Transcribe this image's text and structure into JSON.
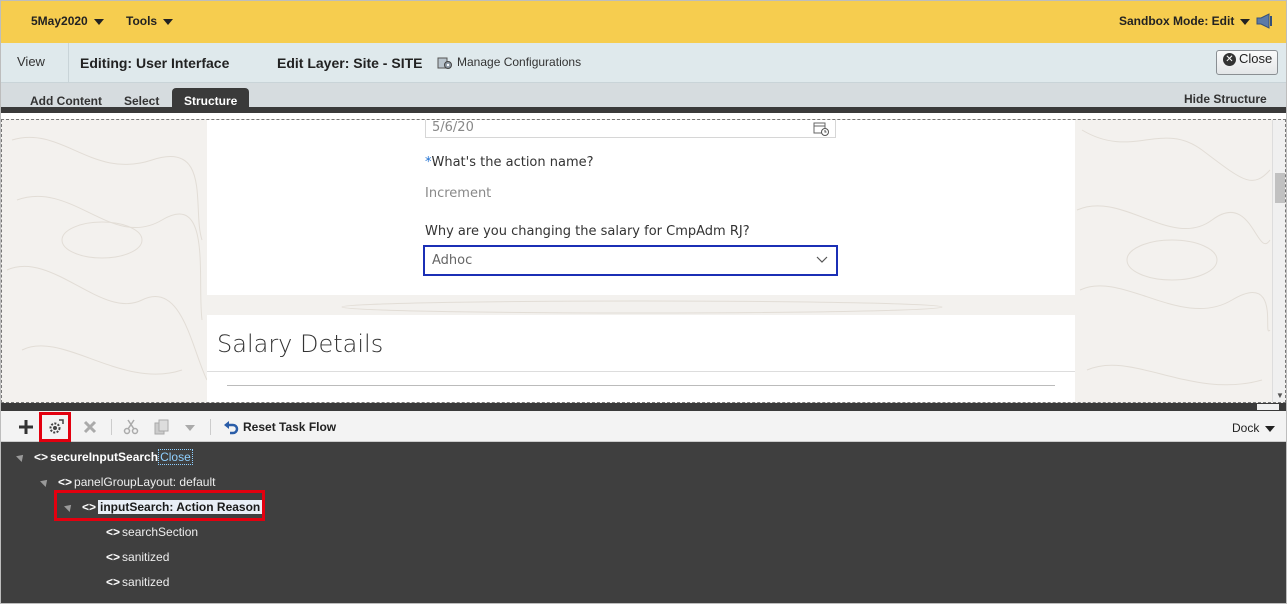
{
  "topbar": {
    "date_menu": "5May2020",
    "tools_menu": "Tools",
    "sandbox_mode": "Sandbox Mode: Edit",
    "colors": {
      "bar": "#f6cd4f"
    },
    "icons": [
      "chevron-down-icon",
      "megaphone-icon"
    ]
  },
  "editbar": {
    "view_tab": "View",
    "editing": "Editing: User Interface",
    "edit_layer": "Edit Layer: Site - SITE",
    "manage_configurations": "Manage Configurations",
    "close_button": "Close"
  },
  "tabs": {
    "items": [
      "Add Content",
      "Select",
      "Structure"
    ],
    "active": "Structure",
    "hide_structure": "Hide Structure"
  },
  "form": {
    "date_value": "5/6/20",
    "action_name_label": "What's the action name?",
    "action_name_required": "*",
    "action_name_value": "Increment",
    "reason_label": "Why are you changing the salary for CmpAdm RJ?",
    "reason_value": "Adhoc",
    "section_title": "Salary Details",
    "colors": {
      "focus_border": "#1b2fb5",
      "required_asterisk": "#1d6fd1"
    }
  },
  "structure_toolbar": {
    "reset_task_flow": "Reset Task Flow",
    "dock": "Dock",
    "icons": [
      "add-icon",
      "properties-gear-icon",
      "delete-icon",
      "cut-icon",
      "copy-icon",
      "dropdown-icon",
      "reset-arrow-icon"
    ]
  },
  "tree": {
    "root": {
      "label": "secureInputSearch",
      "close_link": "Close"
    },
    "panel": "panelGroupLayout: default",
    "selected": "inputSearch: Action Reason",
    "children": [
      "searchSection",
      "sanitized",
      "sanitized"
    ],
    "tag_icon": "<>",
    "colors": {
      "background": "#3f3f3f",
      "highlight": "#e3000f"
    }
  }
}
